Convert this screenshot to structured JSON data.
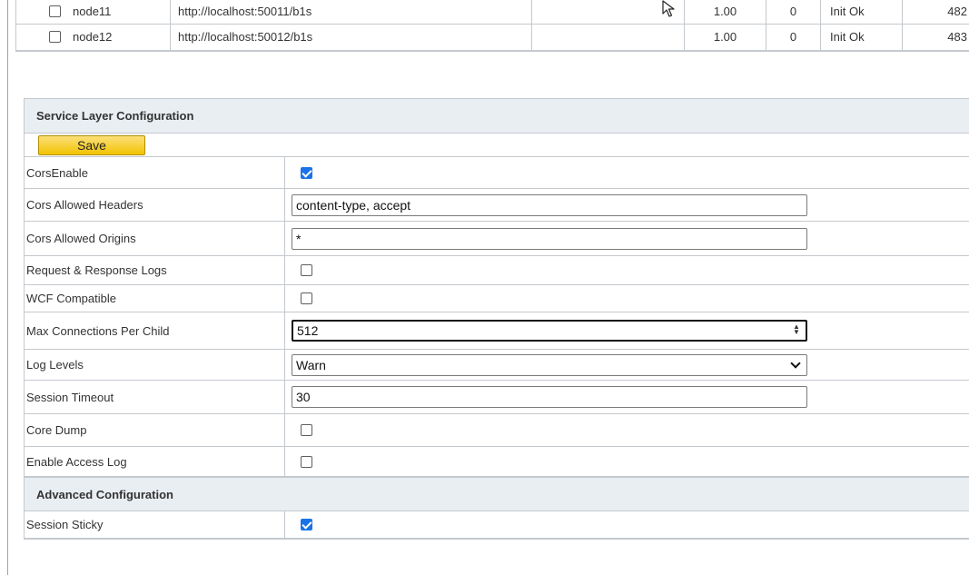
{
  "nodes_table": {
    "rows": [
      {
        "name": "node11",
        "url": "http://localhost:50011/b1s",
        "weight": "1.00",
        "count": "0",
        "status": "Init Ok",
        "pid": "482",
        "checked": false
      },
      {
        "name": "node12",
        "url": "http://localhost:50012/b1s",
        "weight": "1.00",
        "count": "0",
        "status": "Init Ok",
        "pid": "483",
        "checked": false
      }
    ]
  },
  "service_layer": {
    "title": "Service Layer Configuration",
    "save_label": "Save",
    "fields": {
      "cors_enable": {
        "label": "CorsEnable",
        "checked": true
      },
      "cors_headers": {
        "label": "Cors Allowed Headers",
        "value": "content-type, accept"
      },
      "cors_origins": {
        "label": "Cors Allowed Origins",
        "value": "*"
      },
      "req_resp_logs": {
        "label": "Request & Response Logs",
        "checked": false
      },
      "wcf_compatible": {
        "label": "WCF Compatible",
        "checked": false
      },
      "max_connections": {
        "label": "Max Connections Per Child",
        "value": "512"
      },
      "log_levels": {
        "label": "Log Levels",
        "value": "Warn"
      },
      "session_timeout": {
        "label": "Session Timeout",
        "value": "30"
      },
      "core_dump": {
        "label": "Core Dump",
        "checked": false
      },
      "access_log": {
        "label": "Enable Access Log",
        "checked": false
      }
    }
  },
  "advanced": {
    "title": "Advanced Configuration",
    "fields": {
      "session_sticky": {
        "label": "Session Sticky",
        "checked": true
      }
    }
  },
  "colors": {
    "save_button": "#f5cd1e",
    "header_bg": "#e9eef3",
    "checkbox_checked": "#1a73e8",
    "border": "#c4c9ce"
  },
  "icons": {
    "cursor": "mouse-pointer-icon",
    "checkbox": "checkbox-icon",
    "spinner": "spinner-arrows-icon",
    "dropdown": "chevron-down-icon"
  }
}
